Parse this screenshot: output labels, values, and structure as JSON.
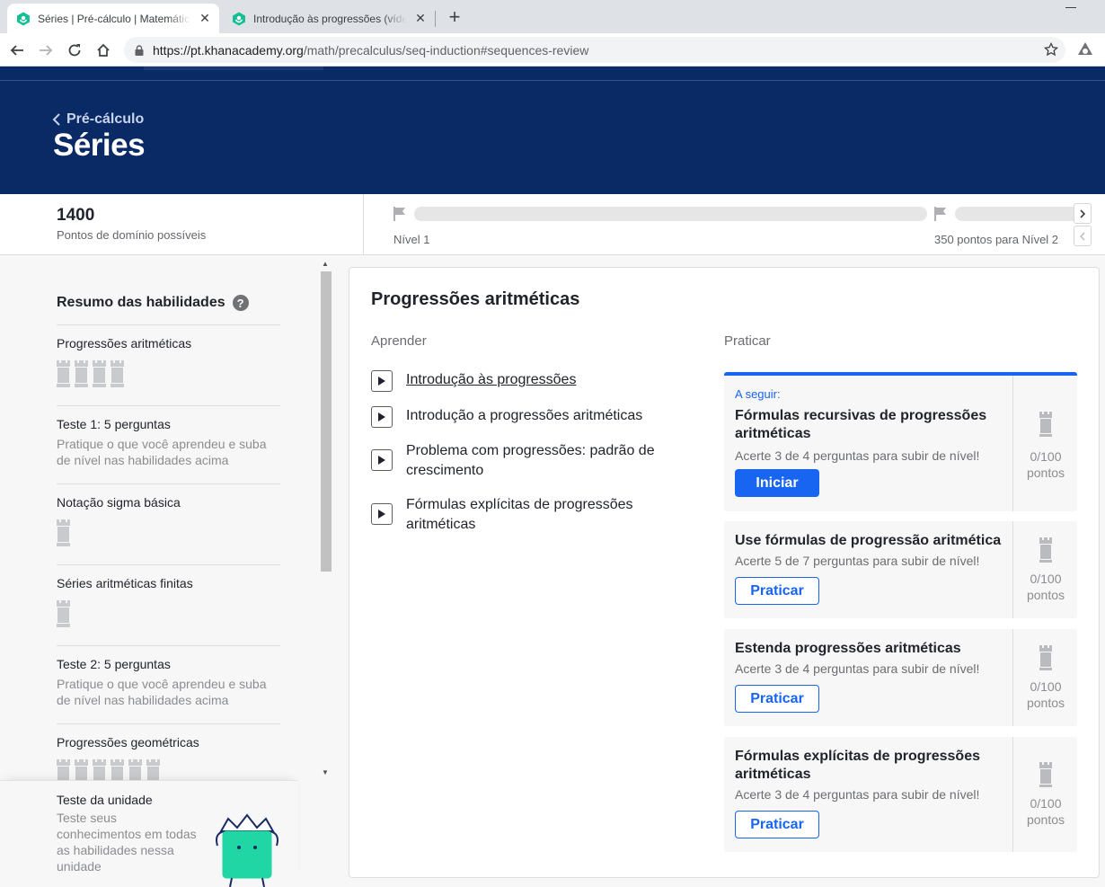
{
  "browser": {
    "tabs": [
      {
        "title": "Séries | Pré-cálculo | Matemática | Khan Academy",
        "active": true
      },
      {
        "title": "Introdução às progressões (vídeo) | Khan Academy",
        "active": false
      }
    ],
    "close_glyph": "✕",
    "new_tab_glyph": "+",
    "url_host": "https://pt.khanacademy.org",
    "url_path": "/math/precalculus/seq-induction#sequences-review"
  },
  "header": {
    "breadcrumb": "Pré-cálculo",
    "title": "Séries",
    "background_color": "#0a2a66"
  },
  "points": {
    "value": "1400",
    "label": "Pontos de domínio possíveis",
    "level_label": "Nível 1",
    "next_level_label": "350 pontos para Nível 2",
    "progress": 0
  },
  "sidebar": {
    "title": "Resumo das habilidades",
    "help_glyph": "?",
    "items": [
      {
        "name": "Progressões aritméticas",
        "towers": 4
      },
      {
        "name": "Teste 1: 5 perguntas",
        "desc": "Pratique o que você aprendeu e suba de nível nas habilidades acima"
      },
      {
        "name": "Notação sigma básica",
        "towers": 1
      },
      {
        "name": "Séries aritméticas finitas",
        "towers": 1
      },
      {
        "name": "Teste 2: 5 perguntas",
        "desc": "Pratique o que você aprendeu e suba de nível nas habilidades acima"
      },
      {
        "name": "Progressões geométricas",
        "towers": 6
      }
    ],
    "unit_test": {
      "name": "Teste da unidade",
      "desc": "Teste seus conhecimentos em todas as habilidades nessa unidade"
    }
  },
  "main": {
    "title": "Progressões aritméticas",
    "learn_label": "Aprender",
    "practice_label": "Praticar",
    "learn_items": [
      {
        "label": "Introdução às progressões"
      },
      {
        "label": "Introdução a progressões aritméticas"
      },
      {
        "label": "Problema com progressões: padrão de crescimento"
      },
      {
        "label": "Fórmulas explícitas de progressões aritméticas"
      }
    ],
    "practice_cards": [
      {
        "kicker": "A seguir:",
        "title": "Fórmulas recursivas de progressões aritméticas",
        "subtitle": "Acerte 3 de 4 perguntas para subir de nível!",
        "button": "Iniciar",
        "score": "0/100",
        "unit": "pontos"
      },
      {
        "title": "Use fórmulas de progressão aritmética",
        "subtitle": "Acerte 5 de 7 perguntas para subir de nível!",
        "button": "Praticar",
        "score": "0/100",
        "unit": "pontos"
      },
      {
        "title": "Estenda progressões aritméticas",
        "subtitle": "Acerte 3 de 4 perguntas para subir de nível!",
        "button": "Praticar",
        "score": "0/100",
        "unit": "pontos"
      },
      {
        "title": "Fórmulas explícitas de progressões aritméticas",
        "subtitle": "Acerte 3 de 4 perguntas para subir de nível!",
        "button": "Praticar",
        "score": "0/100",
        "unit": "pontos"
      }
    ],
    "accent_color": "#1865f2"
  }
}
